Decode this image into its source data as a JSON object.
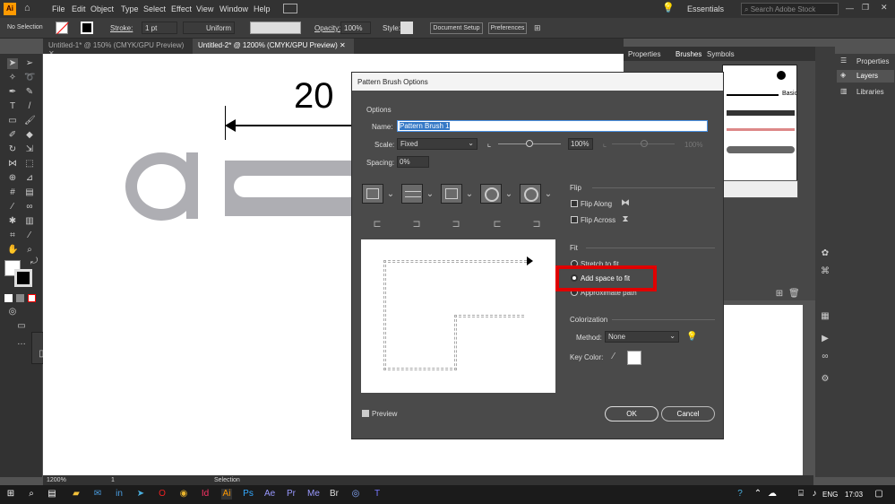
{
  "menu": [
    "File",
    "Edit",
    "Object",
    "Type",
    "Select",
    "Effect",
    "View",
    "Window",
    "Help"
  ],
  "workspace": "Essentials",
  "search_placeholder": "Search Adobe Stock",
  "control": {
    "selection": "No Selection",
    "stroke_label": "Stroke:",
    "stroke_value": "1 pt",
    "profile": "Uniform",
    "opacity_label": "Opacity:",
    "opacity_value": "100%",
    "style_label": "Style:",
    "doc_setup": "Document Setup",
    "prefs": "Preferences"
  },
  "tabs": [
    "Untitled-1* @ 150% (CMYK/GPU Preview)",
    "Untitled-2* @ 1200% (CMYK/GPU Preview)"
  ],
  "canvas_text": "20",
  "panel_tabs": [
    "Properties",
    "Brushes",
    "Symbols"
  ],
  "brush_basic": "Basic",
  "right_panel": [
    "Properties",
    "Layers",
    "Libraries"
  ],
  "dialog": {
    "title": "Pattern Brush Options",
    "options": "Options",
    "name_label": "Name:",
    "name_value": "Pattern Brush 1",
    "scale_label": "Scale:",
    "scale_value": "Fixed",
    "scale_pct": "100%",
    "scale_pct2": "100%",
    "spacing_label": "Spacing:",
    "spacing_value": "0%",
    "flip": "Flip",
    "flip_along": "Flip Along",
    "flip_across": "Flip Across",
    "fit": "Fit",
    "stretch": "Stretch to fit",
    "addspace": "Add space to fit",
    "approx": "Approximate path",
    "colorization": "Colorization",
    "method_label": "Method:",
    "method_value": "None",
    "keycolor_label": "Key Color:",
    "preview": "Preview",
    "ok": "OK",
    "cancel": "Cancel"
  },
  "status": {
    "zoom": "1200%",
    "page": "1",
    "tool": "Selection"
  },
  "taskbar": {
    "lang": "ENG",
    "time": "17:03"
  }
}
